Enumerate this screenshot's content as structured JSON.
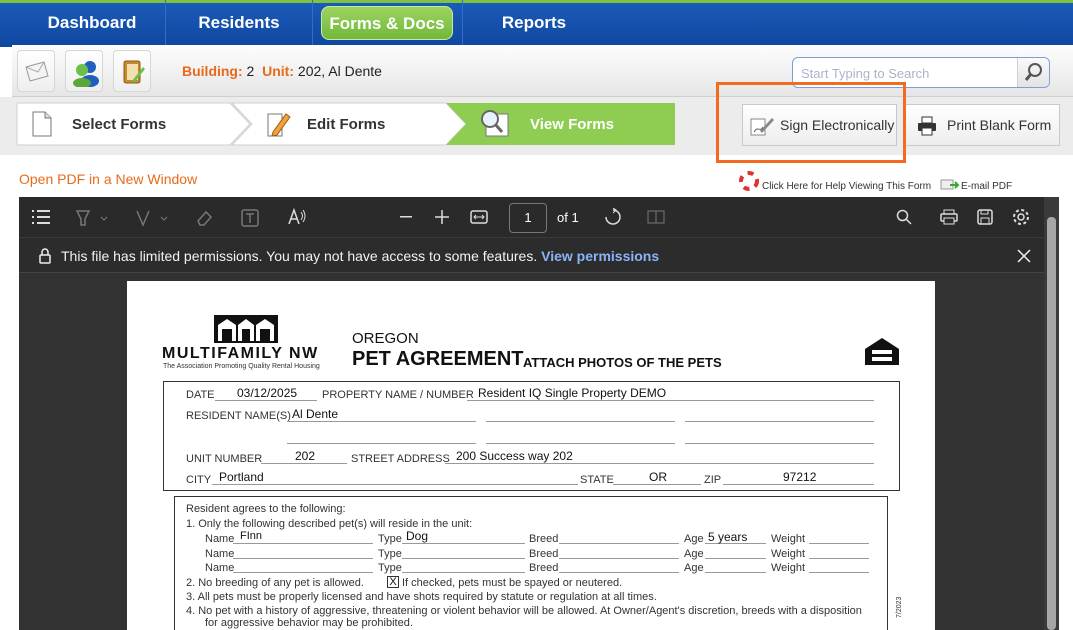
{
  "nav": {
    "dashboard": "Dashboard",
    "residents": "Residents",
    "forms": "Forms & Docs",
    "reports": "Reports"
  },
  "unit_bar": {
    "building_label": "Building:",
    "building_value": "2",
    "unit_label": "Unit:",
    "unit_value": "202, Al Dente"
  },
  "search": {
    "placeholder": "Start Typing to Search"
  },
  "steps": {
    "select": "Select Forms",
    "edit": "Edit Forms",
    "view": "View Forms"
  },
  "actions": {
    "sign": "Sign Electronically",
    "print": "Print Blank Form"
  },
  "links": {
    "open_pdf": "Open PDF in a New Window",
    "help": "Click Here for Help Viewing This Form",
    "email": "E-mail PDF"
  },
  "viewer": {
    "page_current": "1",
    "page_total": "of 1",
    "permission_text": "This file has limited permissions. You may not have access to some features.",
    "permission_link": "View permissions"
  },
  "form": {
    "logo": "MULTIFAMILY NW",
    "logo_sub": "The Association Promoting Quality Rental Housing",
    "state": "OREGON",
    "title": "PET AGREEMENT",
    "subtitle": "ATTACH PHOTOS OF THE PETS",
    "date_label": "DATE",
    "date": "03/12/2025",
    "property_label": "PROPERTY NAME / NUMBER",
    "property": "Resident IQ Single Property DEMO",
    "resident_label": "RESIDENT NAME(S)",
    "resident": "Al Dente",
    "unit_label": "UNIT NUMBER",
    "unit": "202",
    "street_label": "STREET ADDRESS",
    "street": "200 Success way 202",
    "city_label": "CITY",
    "city": "Portland",
    "state_label": "STATE",
    "state_value": "OR",
    "zip_label": "ZIP",
    "zip": "97212",
    "agrees": "Resident agrees to the following:",
    "item1": "1.  Only the following described pet(s) will reside in the unit:",
    "name_label": "Name",
    "type_label": "Type",
    "breed_label": "Breed",
    "age_label": "Age",
    "weight_label": "Weight",
    "pet_name": "FInn",
    "pet_type": "Dog",
    "pet_age": "5 years",
    "item2a": "2.  No breeding of any pet is allowed.",
    "check": "X",
    "item2b": "If checked, pets must be spayed or neutered.",
    "item3": "3.  All pets must be properly licensed and have shots required by statute or regulation at all times.",
    "item4a": "4.  No pet with a history of aggressive, threatening or violent behavior will be allowed. At Owner/Agent's discretion, breeds with a disposition",
    "item4b": "for aggressive behavior may be prohibited.",
    "side_note": "7/2023"
  }
}
